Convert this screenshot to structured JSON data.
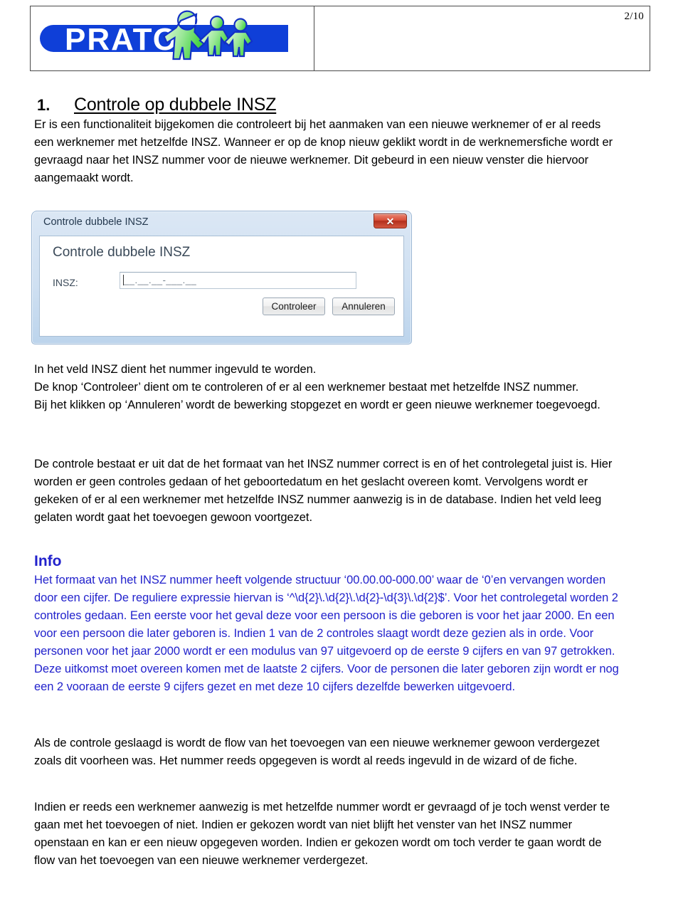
{
  "header": {
    "page_number": "2/10",
    "logo_text": "PRATO",
    "logo_colors": {
      "blue": "#0f3fd8",
      "green_light": "#b9f0b0",
      "green": "#4fd14f",
      "outline": "#1230c4"
    }
  },
  "section": {
    "number": "1.",
    "title": "Controle op dubbele INSZ"
  },
  "paragraphs": {
    "intro": "Er is een functionaliteit bijgekomen die controleert bij het aanmaken van een nieuwe werknemer of er al reeds een werknemer met hetzelfde INSZ. Wanneer er op de knop nieuw geklikt wordt in de werknemersfiche wordt er gevraagd naar het INSZ nummer voor de nieuwe werknemer. Dit gebeurd in een nieuw venster die hiervoor aangemaakt wordt.",
    "after_dialog": "In het veld INSZ dient het nummer ingevuld te worden.\nDe knop ‘Controleer’ dient om te controleren of er al een werknemer bestaat met hetzelfde INSZ nummer.\nBij het klikken op ‘Annuleren’ wordt de bewerking stopgezet en wordt er geen nieuwe werknemer toegevoegd.",
    "detail": "De controle bestaat er uit dat de het formaat van het INSZ nummer correct is en of het controlegetal juist is. Hier worden er geen controles gedaan of het geboortedatum en het geslacht overeen komt. Vervolgens wordt er gekeken of er al een werknemer met hetzelfde INSZ nummer aanwezig is in de database. Indien het veld leeg gelaten wordt gaat het toevoegen gewoon voortgezet.",
    "success": "Als de controle geslaagd is wordt de flow van het toevoegen van een nieuwe werknemer gewoon verdergezet zoals dit voorheen was. Het nummer reeds opgegeven is wordt al reeds ingevuld in de wizard of de fiche.",
    "already_exists": "Indien er reeds een werknemer aanwezig is met hetzelfde nummer wordt er gevraagd of je toch wenst verder te gaan met het toevoegen of niet. Indien er gekozen wordt van niet blijft het venster van het INSZ nummer openstaan en kan er een nieuw opgegeven worden. Indien er gekozen wordt om toch verder te gaan wordt de flow van het toevoegen van een nieuwe werknemer verdergezet."
  },
  "info": {
    "title": "Info",
    "color": "#2222cc",
    "body": "Het formaat van het INSZ nummer heeft volgende structuur ‘00.00.00-000.00’ waar de ‘0’en vervangen worden door een cijfer. De reguliere expressie hiervan is ‘^\\d{2}\\.\\d{2}\\.\\d{2}-\\d{3}\\.\\d{2}$’. Voor het controlegetal worden 2 controles gedaan. Een eerste voor het geval deze voor een persoon is die geboren is voor het jaar 2000. En een voor een persoon die later geboren is. Indien 1 van de 2 controles slaagt wordt deze gezien als in orde. Voor personen voor het jaar 2000 wordt er een modulus van 97 uitgevoerd op de eerste 9 cijfers en van 97 getrokken. Deze uitkomst moet overeen komen met de laatste 2 cijfers. Voor de personen die later geboren zijn wordt er nog een 2 vooraan de eerste 9 cijfers gezet en met deze 10 cijfers dezelfde bewerken uitgevoerd."
  },
  "dialog": {
    "window_title": "Controle dubbele INSZ",
    "close_icon": "close-icon",
    "close_glyph": "✕",
    "heading": "Controle dubbele INSZ",
    "field_label": "INSZ:",
    "field_mask": "__.__.__-___.__",
    "field_value": "",
    "buttons": {
      "confirm": "Controleer",
      "cancel": "Annuleren"
    }
  }
}
